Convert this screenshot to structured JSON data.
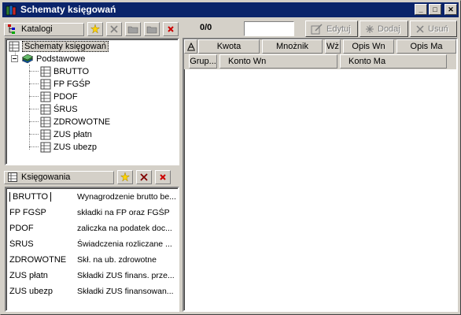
{
  "window": {
    "title": "Schematy księgowań",
    "minimize": "_",
    "maximize": "□",
    "close": "✕"
  },
  "catalog_panel": {
    "caption": "Katalogi",
    "tree": {
      "root": "Schematy księgowań",
      "folder": "Podstawowe",
      "items": [
        "BRUTTO",
        "FP FGŚP",
        "PDOF",
        "ŚRUS",
        "ZDROWOTNE",
        "ZUS płatn",
        "ZUS ubezp"
      ]
    }
  },
  "postings_panel": {
    "caption": "Księgowania",
    "rows": [
      {
        "code": "BRUTTO",
        "desc": "Wynagrodzenie brutto be..."
      },
      {
        "code": "FP FGŚP",
        "desc": "składki na FP oraz FGŚP"
      },
      {
        "code": "PDOF",
        "desc": "zaliczka na podatek doc..."
      },
      {
        "code": "ŚRUS",
        "desc": "Świadczenia rozliczane ..."
      },
      {
        "code": "ZDROWOTNE",
        "desc": "Skł. na ub. zdrowotne"
      },
      {
        "code": "ZUS płatn",
        "desc": "Składki ZUS finans. prze..."
      },
      {
        "code": "ZUS ubezp",
        "desc": "Składki ZUS finansowan..."
      }
    ]
  },
  "toolbar": {
    "counter": "0/0",
    "search_value": "",
    "edit_label": "Edytuj",
    "add_label": "Dodaj",
    "delete_label": "Usuń"
  },
  "grid": {
    "header_row1": [
      "Kwota",
      "Mnożnik",
      "Wż",
      "Opis Wn",
      "Opis Ma"
    ],
    "header_row2": [
      "Grup...",
      "Konto Wn",
      "Konto Ma"
    ]
  },
  "colors": {
    "titlebar": "#0a246a",
    "face": "#d4d0c8",
    "accent_red": "#cc0000",
    "accent_yellow": "#ffd400"
  }
}
